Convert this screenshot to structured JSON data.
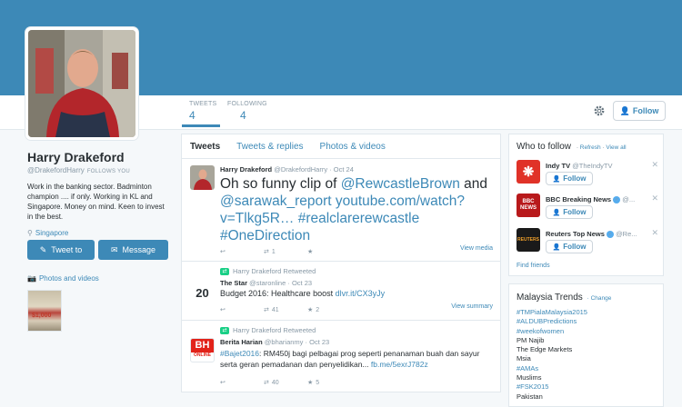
{
  "colors": {
    "accent": "#3d89b7",
    "banner": "#3d89b7",
    "retweet_green": "#19cf86",
    "verified": "#55acee"
  },
  "profile": {
    "name": "Harry Drakeford",
    "handle": "@DrakefordHarry",
    "follows_you": "FOLLOWS YOU",
    "bio": "Work in the banking sector. Badminton champion .... if only. Working in KL and Singapore. Money on mind. Keen to invest in the best.",
    "location": "Singapore",
    "tweet_button": "Tweet to",
    "message_button": "Message",
    "photos_videos": "Photos and videos",
    "thumb_text": "$1,000"
  },
  "nav": {
    "tweets_label": "TWEETS",
    "tweets_value": "4",
    "following_label": "FOLLOWING",
    "following_value": "4",
    "follow_button": "Follow"
  },
  "timeline": {
    "tabs": [
      "Tweets",
      "Tweets & replies",
      "Photos & videos"
    ],
    "tweets": [
      {
        "name": "Harry Drakeford",
        "handle": "@DrakefordHarry",
        "date": "Oct 24",
        "text_plain": "Oh so funny clip of ",
        "mention1": "@RewcastleBrown",
        "and": " and ",
        "mention2": "@sarawak_report",
        "link": " youtube.com/watch?v=Tlkg5R…",
        "hashtag1": " #realclarerewcastle",
        "hashtag2": " #OneDirection",
        "retweets": "1",
        "favorites": "",
        "view": "View media"
      },
      {
        "retweeted_by": "Harry Drakeford Retweeted",
        "name": "The Star",
        "handle": "@staronline",
        "date": "Oct 23",
        "text_plain": "Budget 2016: Healthcare boost ",
        "link": "dlvr.it/CX3yJy",
        "retweets": "41",
        "favorites": "2",
        "view": "View summary",
        "avatar_text": "20"
      },
      {
        "retweeted_by": "Harry Drakeford Retweeted",
        "name": "Berita Harian",
        "handle": "@bharianmy",
        "date": "Oct 23",
        "hashtag": "#Bajet2016",
        "text_plain": ": RM450j bagi pelbagai prog seperti penanaman buah dan sayur serta geran pemadanan dan penyelidikan... ",
        "link": "fb.me/5exrJ782z",
        "retweets": "40",
        "favorites": "5",
        "avatar_text": "BH",
        "avatar_sub": "ONLINE"
      }
    ]
  },
  "who_to_follow": {
    "title": "Who to follow",
    "refresh": "Refresh",
    "view_all": "View all",
    "dot": " · ",
    "suggestions": [
      {
        "name": "Indy TV",
        "handle": "@TheIndyTV",
        "follow": "Follow",
        "logo": "❋",
        "logo_color": "#e03228"
      },
      {
        "name": "BBC Breaking News",
        "handle": "@...",
        "follow": "Follow",
        "logo": "BBC NEWS",
        "logo_color": "#b8191b"
      },
      {
        "name": "Reuters Top News",
        "handle": "@Re...",
        "follow": "Follow",
        "logo": "REUTERS",
        "logo_color": "#1a1a1a"
      }
    ],
    "find_friends": "Find friends"
  },
  "trends": {
    "title": "Malaysia Trends",
    "change": "Change",
    "dot": " · ",
    "items": [
      "#TMPialaMalaysia2015",
      "#ALDUBPredictions",
      "#weekofwomen",
      "PM Najib",
      "The Edge Markets",
      "Msia",
      "#AMAs",
      "Muslims",
      "#FSK2015",
      "Pakistan"
    ]
  }
}
